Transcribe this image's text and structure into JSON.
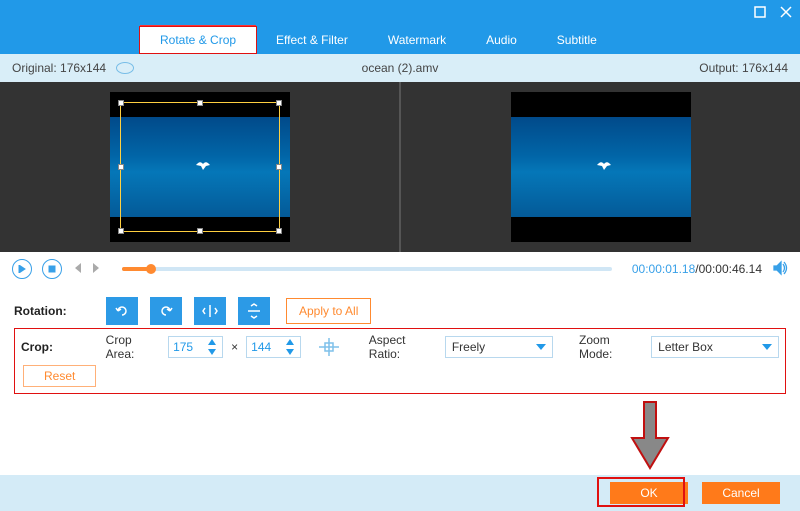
{
  "titlebar": {},
  "tabs": {
    "rotate_crop": "Rotate & Crop",
    "effect_filter": "Effect & Filter",
    "watermark": "Watermark",
    "audio": "Audio",
    "subtitle": "Subtitle"
  },
  "infobar": {
    "original": "Original: 176x144",
    "filename": "ocean (2).amv",
    "output": "Output: 176x144"
  },
  "player": {
    "current": "00:00:01.18",
    "total": "/00:00:46.14"
  },
  "rotation": {
    "label": "Rotation:",
    "apply_all": "Apply to All"
  },
  "crop": {
    "label": "Crop:",
    "area_label": "Crop Area:",
    "width": "175",
    "height": "144",
    "aspect_label": "Aspect Ratio:",
    "aspect_value": "Freely",
    "zoom_label": "Zoom Mode:",
    "zoom_value": "Letter Box",
    "reset": "Reset"
  },
  "footer": {
    "ok": "OK",
    "cancel": "Cancel"
  }
}
